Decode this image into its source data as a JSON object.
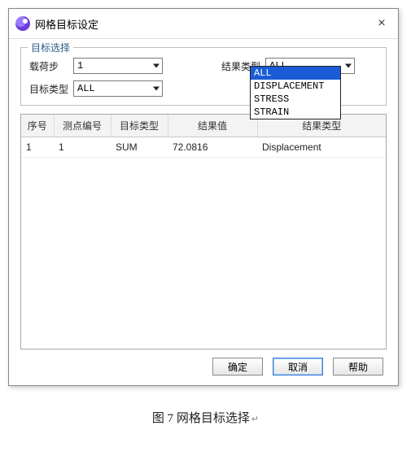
{
  "window": {
    "title": "网格目标设定",
    "close_label": "×"
  },
  "section": {
    "legend": "目标选择",
    "loadstep_label": "载荷步",
    "loadstep_value": "1",
    "target_type_label": "目标类型",
    "target_type_value": "ALL",
    "result_type_label": "结果类型",
    "result_type_value": "ALL",
    "result_type_options": [
      "ALL",
      "DISPLACEMENT",
      "STRESS",
      "STRAIN"
    ]
  },
  "table": {
    "headers": {
      "seq": "序号",
      "mp": "测点编号",
      "tt": "目标类型",
      "rv": "结果值",
      "rt": "结果类型"
    },
    "rows": [
      {
        "seq": "1",
        "mp": "1",
        "tt": "SUM",
        "rv": "72.0816",
        "rt": "Displacement"
      }
    ]
  },
  "buttons": {
    "ok": "确定",
    "cancel": "取消",
    "help": "帮助"
  },
  "caption": "图 7 网格目标选择"
}
